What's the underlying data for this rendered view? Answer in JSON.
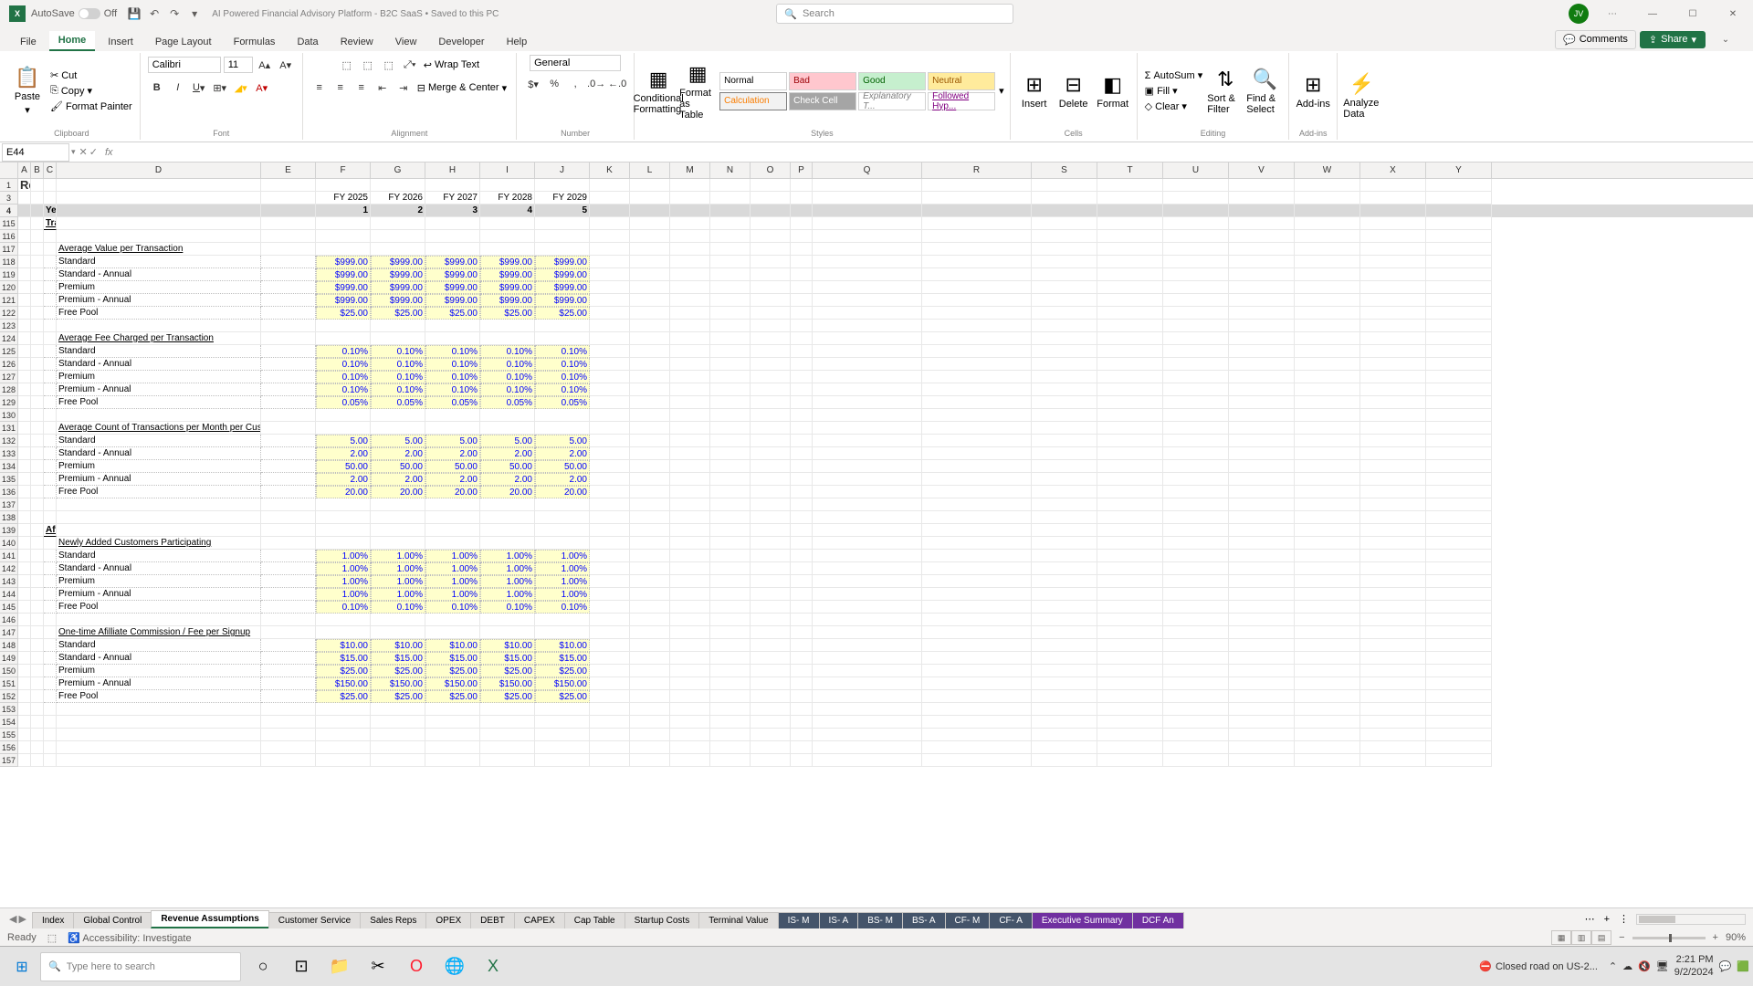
{
  "title": {
    "app": "X",
    "autosave": "AutoSave",
    "autosave_state": "Off",
    "doc": "AI Powered Financial Advisory Platform - B2C SaaS • Saved to this PC",
    "search_ph": "Search",
    "avatar": "JV"
  },
  "tabs": [
    "File",
    "Home",
    "Insert",
    "Page Layout",
    "Formulas",
    "Data",
    "Review",
    "View",
    "Developer",
    "Help"
  ],
  "ribbon_right": {
    "comments": "Comments",
    "share": "Share"
  },
  "ribbon": {
    "clipboard": {
      "label": "Clipboard",
      "paste": "Paste",
      "cut": "Cut",
      "copy": "Copy",
      "fp": "Format Painter"
    },
    "font": {
      "label": "Font",
      "name": "Calibri",
      "size": "11"
    },
    "align": {
      "label": "Alignment",
      "wrap": "Wrap Text",
      "merge": "Merge & Center"
    },
    "number": {
      "label": "Number",
      "fmt": "General"
    },
    "styles": {
      "label": "Styles",
      "cf": "Conditional Formatting",
      "ft": "Format as Table",
      "cells": [
        "Normal",
        "Bad",
        "Good",
        "Neutral",
        "Calculation",
        "Check Cell",
        "Explanatory T...",
        "Followed Hyp..."
      ]
    },
    "cells": {
      "label": "Cells",
      "insert": "Insert",
      "delete": "Delete",
      "format": "Format"
    },
    "editing": {
      "label": "Editing",
      "as": "AutoSum",
      "fill": "Fill",
      "clear": "Clear",
      "sf": "Sort & Filter",
      "fs": "Find & Select"
    },
    "addins": {
      "label": "Add-ins",
      "a": "Add-ins"
    },
    "analyze": {
      "a": "Analyze Data"
    }
  },
  "namebox": "E44",
  "cols": [
    "A",
    "B",
    "C",
    "D",
    "E",
    "F",
    "G",
    "H",
    "I",
    "J",
    "K",
    "L",
    "M",
    "N",
    "O",
    "P",
    "Q",
    "R",
    "S",
    "T",
    "U",
    "V",
    "W",
    "X",
    "Y"
  ],
  "sheet": {
    "title": "Revenue Assumptions",
    "fy": [
      "FY 2025",
      "FY 2026",
      "FY 2027",
      "FY 2028",
      "FY 2029"
    ],
    "year_label": "Year:",
    "years": [
      "1",
      "2",
      "3",
      "4",
      "5"
    ],
    "sec115": "Transaction Fees (If the platform faciliates users to transact, the platform may get a small percentage of the transactions faciliated).",
    "avpt": "Average Value per Transaction",
    "tiers": [
      "Standard",
      "Standard - Annual",
      "Premium",
      "Premium - Annual",
      "Free Pool"
    ],
    "avpt_vals": [
      [
        "$999.00",
        "$999.00",
        "$999.00",
        "$999.00",
        "$999.00"
      ],
      [
        "$999.00",
        "$999.00",
        "$999.00",
        "$999.00",
        "$999.00"
      ],
      [
        "$999.00",
        "$999.00",
        "$999.00",
        "$999.00",
        "$999.00"
      ],
      [
        "$999.00",
        "$999.00",
        "$999.00",
        "$999.00",
        "$999.00"
      ],
      [
        "$25.00",
        "$25.00",
        "$25.00",
        "$25.00",
        "$25.00"
      ]
    ],
    "afct": "Average Fee Charged per Transaction",
    "afct_vals": [
      [
        "0.10%",
        "0.10%",
        "0.10%",
        "0.10%",
        "0.10%"
      ],
      [
        "0.10%",
        "0.10%",
        "0.10%",
        "0.10%",
        "0.10%"
      ],
      [
        "0.10%",
        "0.10%",
        "0.10%",
        "0.10%",
        "0.10%"
      ],
      [
        "0.10%",
        "0.10%",
        "0.10%",
        "0.10%",
        "0.10%"
      ],
      [
        "0.05%",
        "0.05%",
        "0.05%",
        "0.05%",
        "0.05%"
      ]
    ],
    "act": "Average Count of Transactions per Month per Customer",
    "act_vals": [
      [
        "5.00",
        "5.00",
        "5.00",
        "5.00",
        "5.00"
      ],
      [
        "2.00",
        "2.00",
        "2.00",
        "2.00",
        "2.00"
      ],
      [
        "50.00",
        "50.00",
        "50.00",
        "50.00",
        "50.00"
      ],
      [
        "2.00",
        "2.00",
        "2.00",
        "2.00",
        "2.00"
      ],
      [
        "20.00",
        "20.00",
        "20.00",
        "20.00",
        "20.00"
      ]
    ],
    "sec139": "Affiliate Partnerships or Other One-time Revenue",
    "nacp": "Newly Added Customers Participating",
    "nacp_vals": [
      [
        "1.00%",
        "1.00%",
        "1.00%",
        "1.00%",
        "1.00%"
      ],
      [
        "1.00%",
        "1.00%",
        "1.00%",
        "1.00%",
        "1.00%"
      ],
      [
        "1.00%",
        "1.00%",
        "1.00%",
        "1.00%",
        "1.00%"
      ],
      [
        "1.00%",
        "1.00%",
        "1.00%",
        "1.00%",
        "1.00%"
      ],
      [
        "0.10%",
        "0.10%",
        "0.10%",
        "0.10%",
        "0.10%"
      ]
    ],
    "otac": "One-time Afilliate Commission / Fee per Signup",
    "otac_vals": [
      [
        "$10.00",
        "$10.00",
        "$10.00",
        "$10.00",
        "$10.00"
      ],
      [
        "$15.00",
        "$15.00",
        "$15.00",
        "$15.00",
        "$15.00"
      ],
      [
        "$25.00",
        "$25.00",
        "$25.00",
        "$25.00",
        "$25.00"
      ],
      [
        "$150.00",
        "$150.00",
        "$150.00",
        "$150.00",
        "$150.00"
      ],
      [
        "$25.00",
        "$25.00",
        "$25.00",
        "$25.00",
        "$25.00"
      ]
    ]
  },
  "rows_visible": [
    "1",
    "3",
    "4",
    "115",
    "116",
    "117",
    "118",
    "119",
    "120",
    "121",
    "122",
    "123",
    "124",
    "125",
    "126",
    "127",
    "128",
    "129",
    "130",
    "131",
    "132",
    "133",
    "134",
    "135",
    "136",
    "137",
    "138",
    "139",
    "140",
    "141",
    "142",
    "143",
    "144",
    "145",
    "146",
    "147",
    "148",
    "149",
    "150",
    "151",
    "152",
    "153",
    "154",
    "155",
    "156",
    "157"
  ],
  "sheets": [
    {
      "n": "Index",
      "c": ""
    },
    {
      "n": "Global Control",
      "c": ""
    },
    {
      "n": "Revenue Assumptions",
      "c": "active"
    },
    {
      "n": "Customer Service",
      "c": ""
    },
    {
      "n": "Sales Reps",
      "c": ""
    },
    {
      "n": "OPEX",
      "c": ""
    },
    {
      "n": "DEBT",
      "c": ""
    },
    {
      "n": "CAPEX",
      "c": ""
    },
    {
      "n": "Cap Table",
      "c": ""
    },
    {
      "n": "Startup Costs",
      "c": ""
    },
    {
      "n": "Terminal Value",
      "c": ""
    },
    {
      "n": "IS- M",
      "c": "dark"
    },
    {
      "n": "IS- A",
      "c": "dark"
    },
    {
      "n": "BS- M",
      "c": "dark"
    },
    {
      "n": "BS- A",
      "c": "dark"
    },
    {
      "n": "CF- M",
      "c": "dark"
    },
    {
      "n": "CF- A",
      "c": "dark"
    },
    {
      "n": "Executive Summary",
      "c": "purple"
    },
    {
      "n": "DCF An",
      "c": "purple"
    }
  ],
  "status": {
    "ready": "Ready",
    "acc": "Accessibility: Investigate",
    "news": "Closed road on US-2...",
    "zoom": "90%",
    "time": "2:21 PM",
    "date": "9/2/2024",
    "search_ph": "Type here to search"
  }
}
